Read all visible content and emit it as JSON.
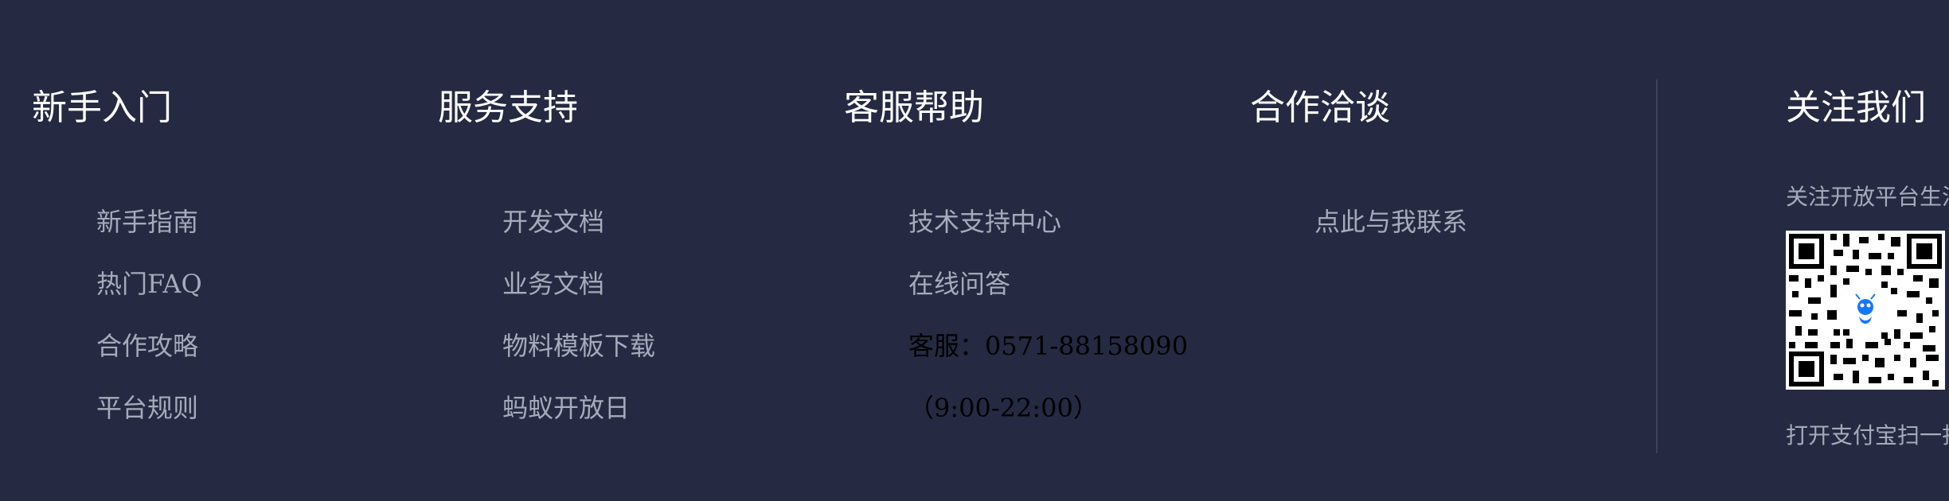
{
  "columns": [
    {
      "title": "新手入门",
      "items": [
        "新手指南",
        "热门FAQ",
        "合作攻略",
        "平台规则"
      ]
    },
    {
      "title": "服务支持",
      "items": [
        "开发文档",
        "业务文档",
        "物料模板下载",
        "蚂蚁开放日"
      ]
    },
    {
      "title": "客服帮助",
      "items": [
        "技术支持中心",
        "在线问答"
      ],
      "hotline": "客服：0571-88158090",
      "hours": "（9:00-22:00）"
    },
    {
      "title": "合作洽谈",
      "items": [
        "点此与我联系"
      ]
    }
  ],
  "follow": {
    "title": "关注我们",
    "text": "关注开放平台生活号",
    "qr_icon": "qr-code-icon",
    "scan_text": "打开支付宝扫一扫"
  },
  "colors": {
    "background": "#252a42",
    "heading": "#ffffff",
    "link": "#a7aabb",
    "divider": "#3c4058",
    "qr_logo": "#1677ff"
  }
}
